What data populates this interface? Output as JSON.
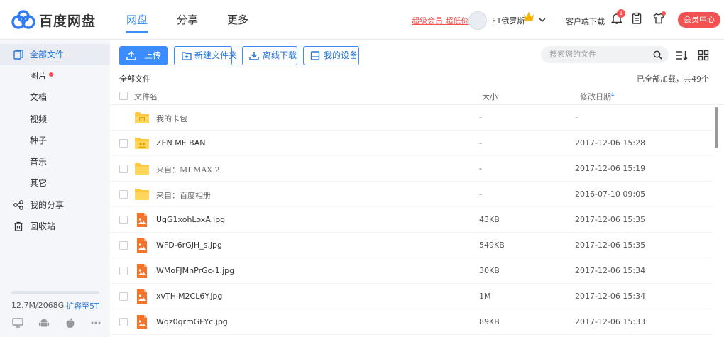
{
  "app": {
    "logo_text": "百度网盘",
    "brand_color": "#3b8cff",
    "accent_red": "#f25252"
  },
  "nav": {
    "tabs": [
      {
        "label": "网盘",
        "active": true
      },
      {
        "label": "分享",
        "active": false
      },
      {
        "label": "更多",
        "active": false
      }
    ]
  },
  "header": {
    "promo": "超级会员 超低价",
    "username": "F1俄罗斯",
    "client_download": "客户端下载",
    "notification_count": "1",
    "vip_center": "会员中心",
    "icons": [
      "bell-icon",
      "clipboard-icon",
      "shirt-icon"
    ]
  },
  "sidebar": {
    "items": [
      {
        "label": "全部文件",
        "icon": "files-icon",
        "active": true
      },
      {
        "label": "图片",
        "icon": "",
        "active": false,
        "dot": true
      },
      {
        "label": "文档",
        "icon": "",
        "active": false
      },
      {
        "label": "视频",
        "icon": "",
        "active": false
      },
      {
        "label": "种子",
        "icon": "",
        "active": false
      },
      {
        "label": "音乐",
        "icon": "",
        "active": false
      },
      {
        "label": "其它",
        "icon": "",
        "active": false
      },
      {
        "label": "我的分享",
        "icon": "share-icon",
        "active": false
      },
      {
        "label": "回收站",
        "icon": "trash-icon",
        "active": false
      }
    ],
    "quota": "12.7M/2068G",
    "upgrade": "扩容至5T",
    "platforms": [
      "desktop-icon",
      "android-icon",
      "apple-icon",
      "more-icon"
    ]
  },
  "toolbar": {
    "upload": "上传",
    "new_folder": "新建文件夹",
    "offline_download": "离线下载",
    "my_devices": "我的设备",
    "search_placeholder": "搜索您的文件"
  },
  "listing": {
    "breadcrumb": "全部文件",
    "loaded_status": "已全部加载，共49个",
    "columns": {
      "name": "文件名",
      "size": "大小",
      "date": "修改日期"
    },
    "sort_indicator": "↓",
    "rows": [
      {
        "name": "我的卡包",
        "size": "-",
        "date": "-",
        "type": "card-folder",
        "muted": true,
        "checkbox": false
      },
      {
        "name": "ZEN ME BAN",
        "size": "-",
        "date": "2017-12-06 15:28",
        "type": "shared-folder",
        "muted": false,
        "checkbox": true
      },
      {
        "name": "来自：MI MAX 2",
        "size": "-",
        "date": "2017-12-06 15:19",
        "type": "folder",
        "muted": true,
        "checkbox": true
      },
      {
        "name": "来自：百度相册",
        "size": "-",
        "date": "2016-07-10 09:05",
        "type": "folder",
        "muted": true,
        "checkbox": true
      },
      {
        "name": "UqG1xohLoxA.jpg",
        "size": "43KB",
        "date": "2017-12-06 15:35",
        "type": "image",
        "muted": false,
        "checkbox": true
      },
      {
        "name": "WFD-6rGJH_s.jpg",
        "size": "549KB",
        "date": "2017-12-06 15:35",
        "type": "image",
        "muted": false,
        "checkbox": true
      },
      {
        "name": "WMoFJMnPrGc-1.jpg",
        "size": "30KB",
        "date": "2017-12-06 15:34",
        "type": "image",
        "muted": false,
        "checkbox": true
      },
      {
        "name": "xvTHiM2CL6Y.jpg",
        "size": "1M",
        "date": "2017-12-06 15:34",
        "type": "image",
        "muted": false,
        "checkbox": true
      },
      {
        "name": "Wqz0qrmGFYc.jpg",
        "size": "89KB",
        "date": "2017-12-06 15:33",
        "type": "image",
        "muted": false,
        "checkbox": true
      }
    ]
  }
}
